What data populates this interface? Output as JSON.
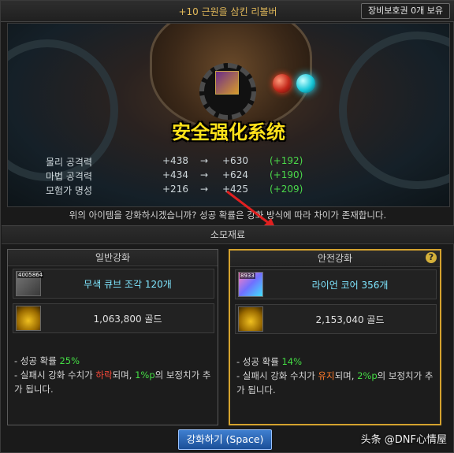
{
  "header": {
    "title": "+10 근원을 삼킨 리볼버",
    "voucher": "장비보호권 0개 보유"
  },
  "scene": {
    "safe_title": "安全强化系统"
  },
  "stats": [
    {
      "name": "물리 공격력",
      "from": "+438",
      "arrow": "→",
      "to": "+630",
      "diff": "(+192)"
    },
    {
      "name": "마법 공격력",
      "from": "+434",
      "arrow": "→",
      "to": "+624",
      "diff": "(+190)"
    },
    {
      "name": "모험가 명성",
      "from": "+216",
      "arrow": "→",
      "to": "+425",
      "diff": "(+209)"
    }
  ],
  "question": "위의 아이템을 강화하시겠습니까? 성공 확률은 강화 방식에 따라 차이가 존재합니다.",
  "materials_header": "소모재료",
  "normal": {
    "title": "일반강화",
    "item_qty": "4005864",
    "item_label": "무색 큐브 조각 120개",
    "gold_label": "1,063,800 골드",
    "note1_prefix": "- 성공 확률 ",
    "note1_rate": "25%",
    "note2_a": "- 실패시 강화 수치가 ",
    "note2_red": "하락",
    "note2_b": "되며, ",
    "note2_green": "1%p",
    "note2_c": "의 보정치가 추가 됩니다."
  },
  "safe": {
    "title": "안전강화",
    "help": "?",
    "item_qty": "8933",
    "item_label": "라이언 코어 356개",
    "gold_label": "2,153,040 골드",
    "note1_prefix": "- 성공 확률 ",
    "note1_rate": "14%",
    "note2_a": "- 실패시 강화 수치가 ",
    "note2_red": "유지",
    "note2_b": "되며, ",
    "note2_green": "2%p",
    "note2_c": "의 보정치가 추가 됩니다."
  },
  "button": {
    "label": "강화하기 (Space)"
  },
  "watermark": "头条 @DNF心情屋",
  "colors": {
    "accent_gold": "#d4a22e",
    "title_yellow": "#ffe21a",
    "diff_green": "#4ad84a",
    "fail_red": "#ff4a3a"
  }
}
